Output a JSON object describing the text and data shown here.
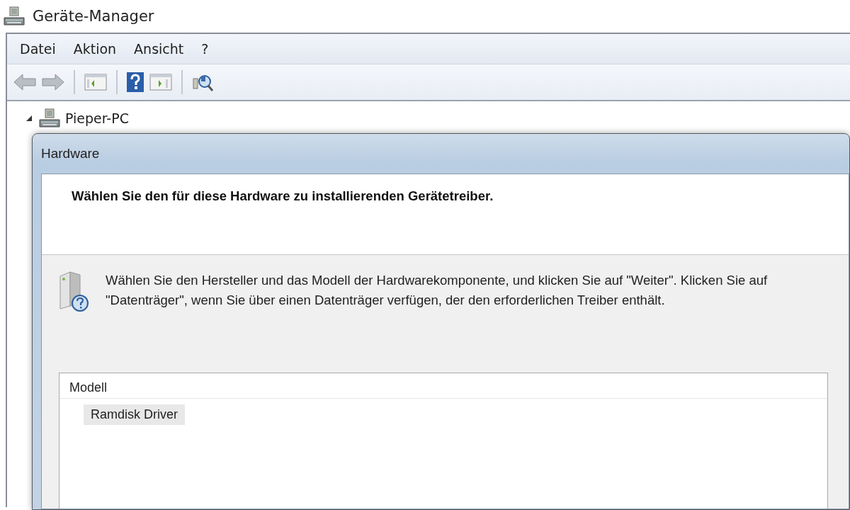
{
  "window": {
    "title": "Geräte-Manager"
  },
  "menu": [
    "Datei",
    "Aktion",
    "Ansicht",
    "?"
  ],
  "toolbar": [
    {
      "kind": "back"
    },
    {
      "kind": "forward"
    },
    {
      "kind": "separator"
    },
    {
      "kind": "tree-pane"
    },
    {
      "kind": "separator"
    },
    {
      "kind": "help"
    },
    {
      "kind": "action-pane"
    },
    {
      "kind": "separator"
    },
    {
      "kind": "scan"
    }
  ],
  "tree": [
    {
      "label": "Pieper-PC",
      "expanded": true
    }
  ],
  "dialog": {
    "title": "Hardware",
    "heading": "Wählen Sie den für diese Hardware zu installierenden Gerätetreiber.",
    "description": "Wählen Sie den Hersteller und das Modell der Hardwarekomponente, und klicken Sie auf \"Weiter\". Klicken Sie auf \"Datenträger\", wenn Sie über einen Datenträger verfügen, der den erforderlichen Treiber enthält.",
    "list": {
      "column": "Modell",
      "items": [
        {
          "label": "Ramdisk Driver",
          "selected": true
        }
      ]
    }
  }
}
